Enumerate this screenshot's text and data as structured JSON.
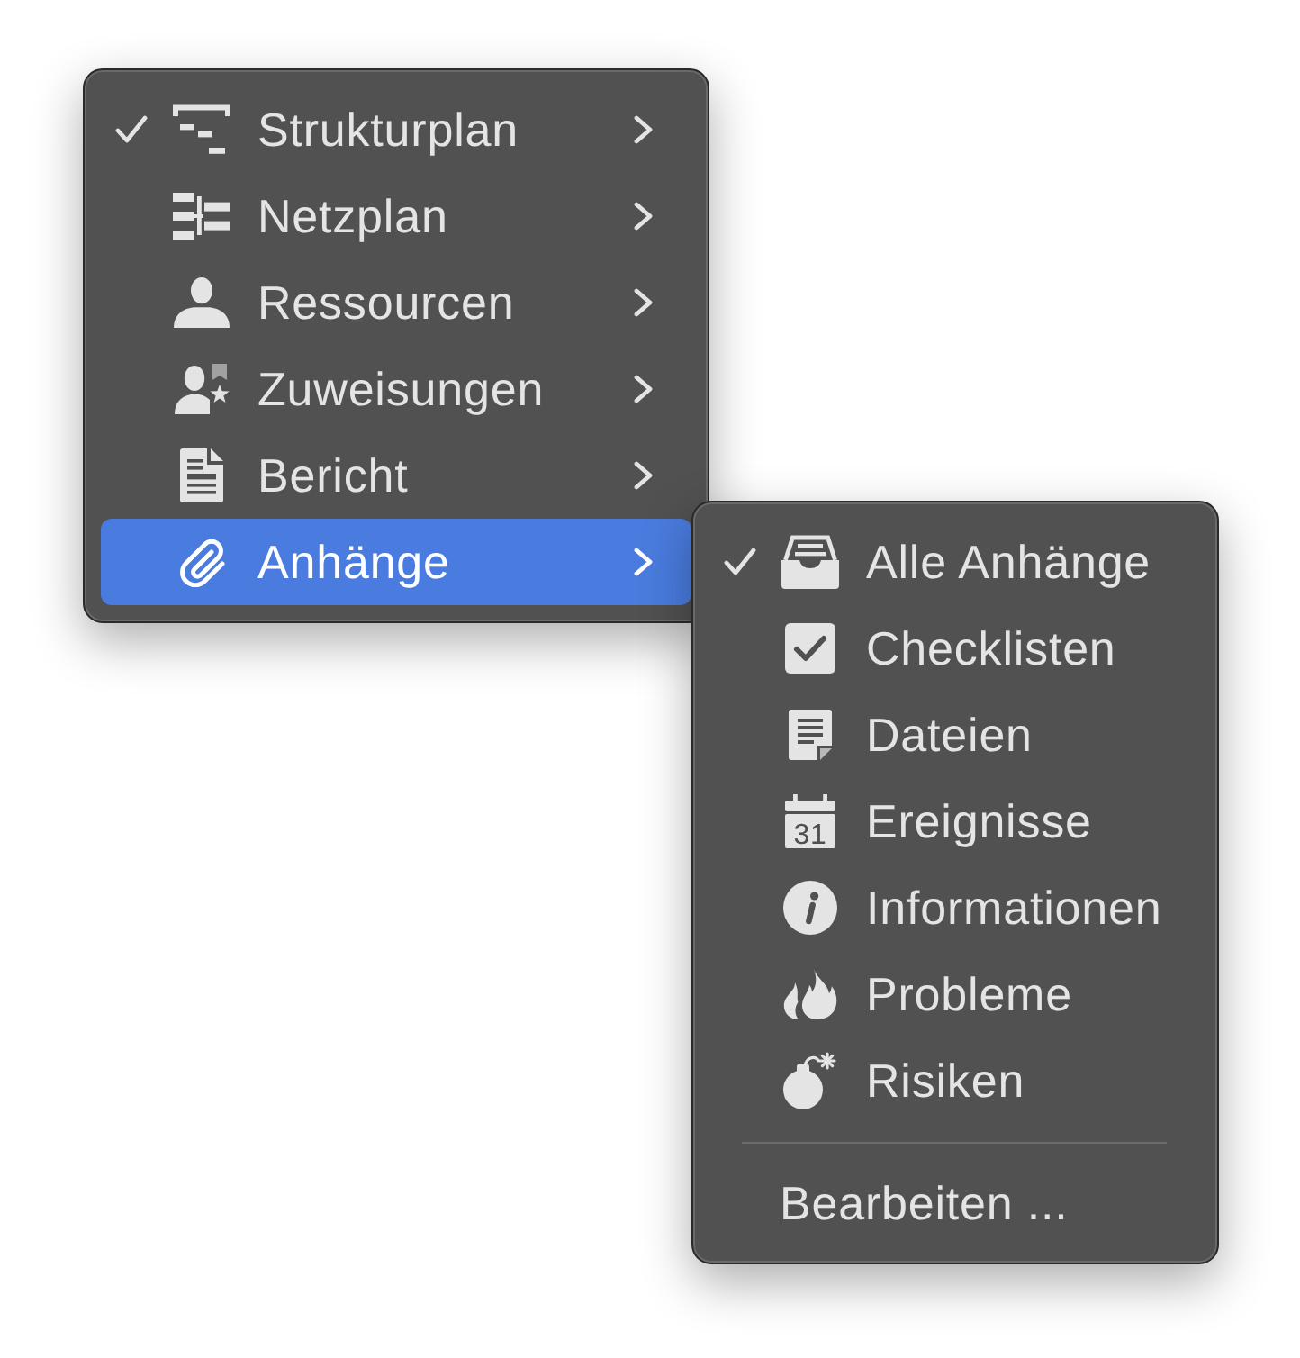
{
  "menu": {
    "items": [
      {
        "label": "Strukturplan",
        "checked": true,
        "selected": false
      },
      {
        "label": "Netzplan",
        "checked": false,
        "selected": false
      },
      {
        "label": "Ressourcen",
        "checked": false,
        "selected": false
      },
      {
        "label": "Zuweisungen",
        "checked": false,
        "selected": false
      },
      {
        "label": "Bericht",
        "checked": false,
        "selected": false
      },
      {
        "label": "Anhänge",
        "checked": false,
        "selected": true
      }
    ]
  },
  "submenu": {
    "items": [
      {
        "label": "Alle Anhänge",
        "checked": true,
        "selected": false
      },
      {
        "label": "Checklisten",
        "checked": false,
        "selected": false
      },
      {
        "label": "Dateien",
        "checked": false,
        "selected": false
      },
      {
        "label": "Ereignisse",
        "calendar_day": "31",
        "checked": false,
        "selected": false
      },
      {
        "label": "Informationen",
        "checked": false,
        "selected": false
      },
      {
        "label": "Probleme",
        "checked": false,
        "selected": false
      },
      {
        "label": "Risiken",
        "checked": false,
        "selected": false
      }
    ],
    "actions": [
      {
        "label": "Bearbeiten ...",
        "selected": false
      }
    ]
  }
}
